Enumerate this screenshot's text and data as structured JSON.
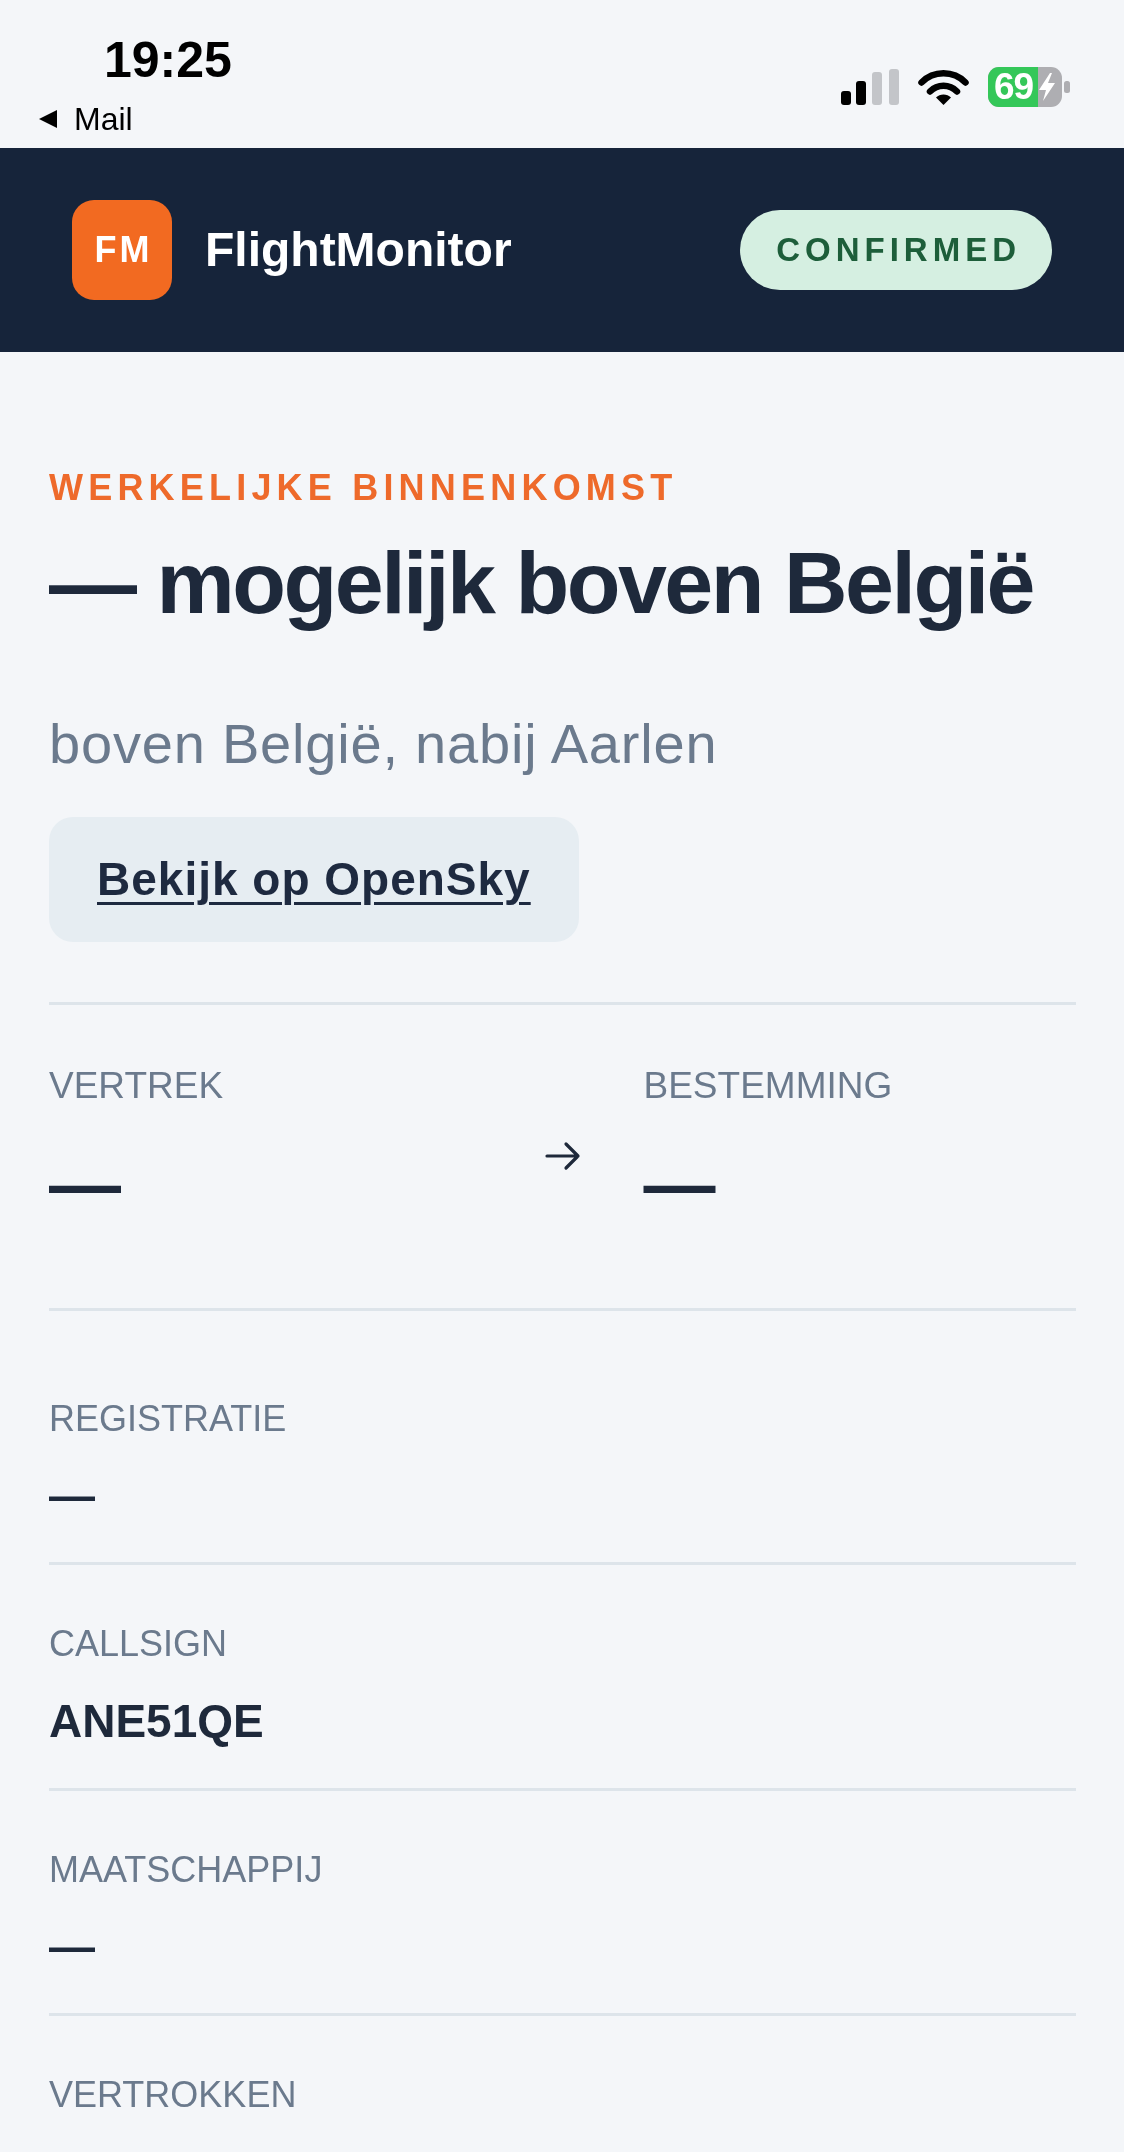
{
  "status_bar": {
    "time": "19:25",
    "back_label": "Mail",
    "battery_text": "69",
    "battery_charging": true
  },
  "header": {
    "logo_text": "FM",
    "app_name": "FlightMonitor",
    "status": {
      "label": "CONFIRMED",
      "kind": "confirmed"
    }
  },
  "arrival": {
    "eyebrow": "WERKELIJKE BINNENKOMST",
    "title": "— mogelijk boven België",
    "location": "boven België, nabij Aarlen",
    "link_label": "Bekijk op OpenSky"
  },
  "route": {
    "from": {
      "label": "VERTREK",
      "value": "—"
    },
    "to": {
      "label": "BESTEMMING",
      "value": "—"
    }
  },
  "details": [
    {
      "label": "REGISTRATIE",
      "value": "—"
    },
    {
      "label": "CALLSIGN",
      "value": "ANE51QE"
    },
    {
      "label": "MAATSCHAPPIJ",
      "value": "—"
    },
    {
      "label": "VERTROKKEN"
    }
  ]
}
